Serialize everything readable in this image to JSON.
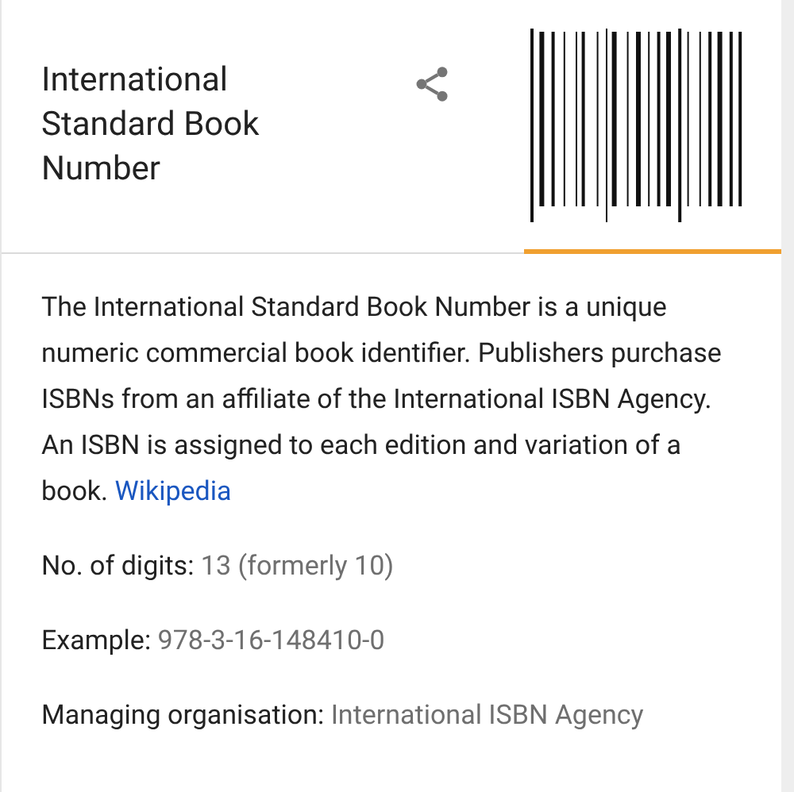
{
  "header": {
    "title": "International Standard Book Number"
  },
  "description": {
    "text": "The International Standard Book Number is a unique numeric commercial book identifier. Publishers purchase ISBNs from an affiliate of the International ISBN Agency. An ISBN is assigned to each edition and variation of a book.",
    "source_link": "Wikipedia"
  },
  "facts": [
    {
      "label": "No. of digits:",
      "value": "13 (formerly 10)"
    },
    {
      "label": "Example:",
      "value": "978-3-16-148410-0"
    },
    {
      "label": "Managing organisation:",
      "value": "International ISBN Agency"
    }
  ]
}
